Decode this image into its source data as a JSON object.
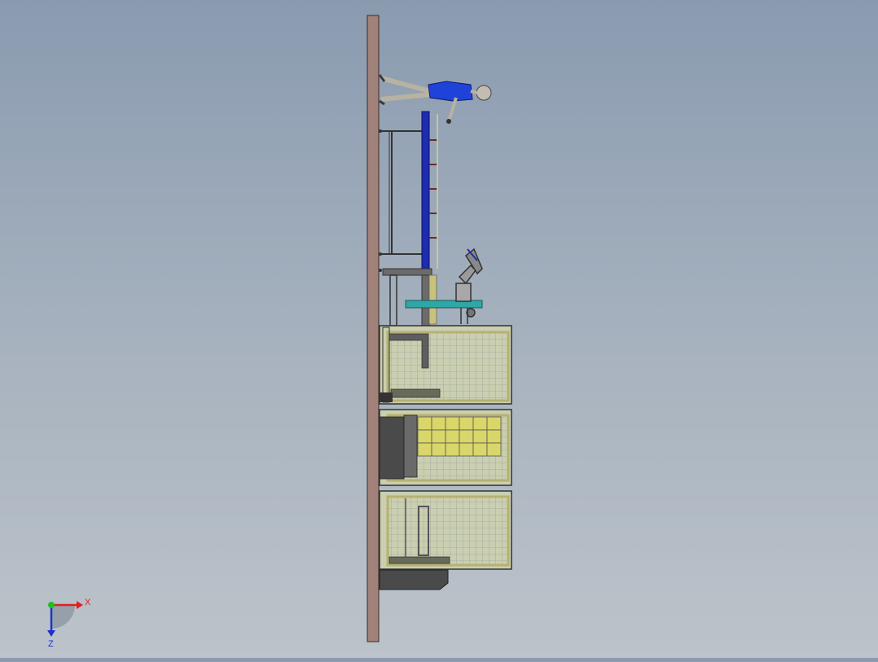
{
  "view": {
    "type": "cad-3d-viewport",
    "background_top": "#8a9bb0",
    "background_bottom": "#bcc3ca"
  },
  "triad": {
    "x_label": "X",
    "z_label": "Z",
    "x_color": "#e02020",
    "y_color": "#20c020",
    "z_color": "#2030d0"
  },
  "colors": {
    "post": "#a0827a",
    "frame": "#4a4a4a",
    "ladder": "#1d2cb0",
    "shelf": "#2fa7a7",
    "mesh": "#c9cfb0",
    "panel_trim": "#b8b070",
    "crate": "#d9d66a",
    "figure": "#1f43d8"
  }
}
